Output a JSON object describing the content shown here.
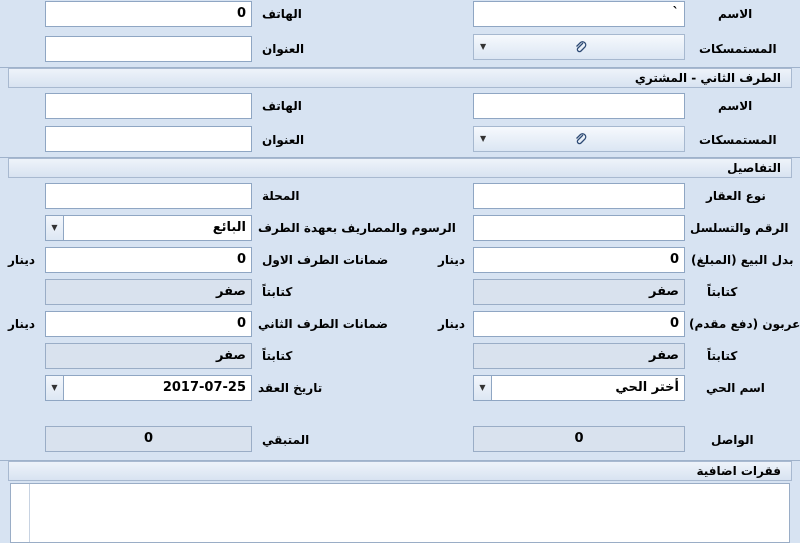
{
  "party1": {
    "name_label": "الاسم",
    "name_value": "`",
    "phone_label": "الهاتف",
    "phone_value": "0",
    "docs_label": "المستمسكات",
    "address_label": "العنوان",
    "address_value": ""
  },
  "party2": {
    "title": "الطرف الثاني - المشتري",
    "name_label": "الاسم",
    "name_value": "",
    "phone_label": "الهاتف",
    "phone_value": "",
    "docs_label": "المستمسكات",
    "address_label": "العنوان",
    "address_value": ""
  },
  "details": {
    "title": "التفاصيل",
    "property_type_label": "نوع العقار",
    "property_type_value": "",
    "locality_label": "المحلة",
    "locality_value": "",
    "serial_label": "الرقم والتسلسل",
    "serial_value": "",
    "fees_label": "الرسوم والمصاريف بعهدة الطرف",
    "fees_value": "البائع",
    "price_label": "بدل البيع (المبلغ)",
    "price_value": "0",
    "price_currency": "دينار",
    "guarantee1_label": "ضمانات الطرف الاول",
    "guarantee1_value": "0",
    "guarantee1_currency": "دينار",
    "written_label": "كتابتاً",
    "price_written": "صفر",
    "guarantee1_written": "صفر",
    "deposit_label": "عربون (دفع مقدم)",
    "deposit_value": "0",
    "deposit_currency": "دينار",
    "guarantee2_label": "ضمانات الطرف الثاني",
    "guarantee2_value": "0",
    "guarantee2_currency": "دينار",
    "deposit_written": "صفر",
    "guarantee2_written": "صفر",
    "district_label": "اسم الحي",
    "district_value": "أختر الحي",
    "contract_date_label": "تاريخ العقد",
    "contract_date_value": "2017-07-25",
    "received_label": "الواصل",
    "received_value": "0",
    "remaining_label": "المتبقي",
    "remaining_value": "0"
  },
  "extra": {
    "title": "فقرات اضافية",
    "value": ""
  },
  "colors": {
    "background": "#d7e3f2",
    "border": "#8fa6c3",
    "readonly": "#d9e2ee"
  }
}
